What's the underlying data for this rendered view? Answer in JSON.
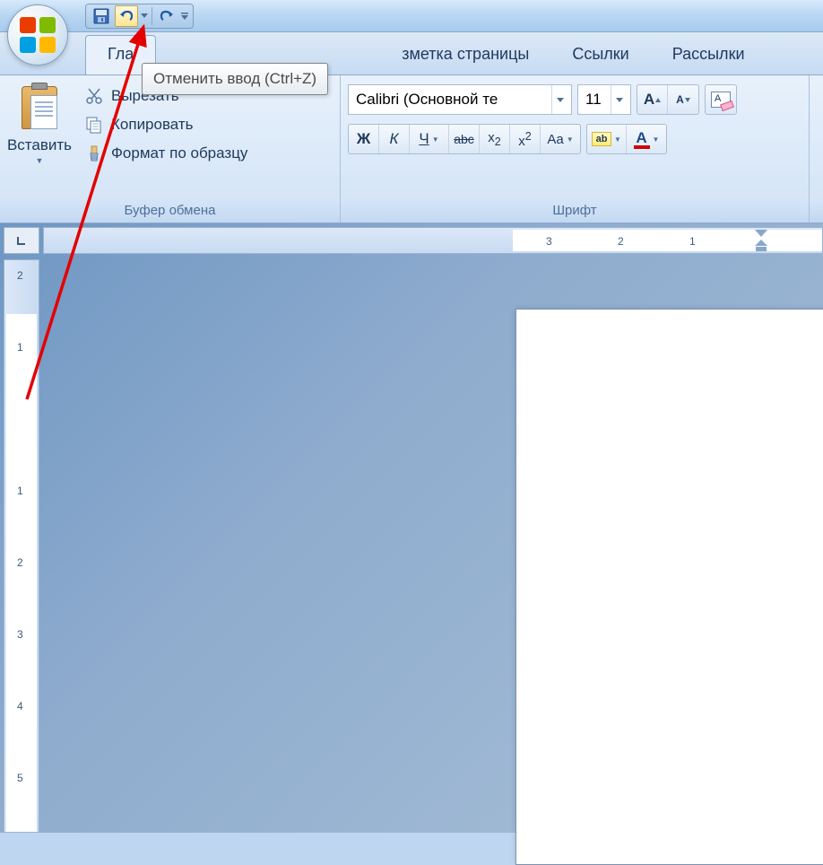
{
  "qat": {
    "save_icon": "save-icon",
    "undo_icon": "undo-icon",
    "redo_icon": "redo-icon"
  },
  "tooltip_text": "Отменить ввод (Ctrl+Z)",
  "tabs": {
    "home": "Гла",
    "page_layout": "зметка страницы",
    "references": "Ссылки",
    "mailings": "Рассылки"
  },
  "clipboard": {
    "paste_label": "Вставить",
    "cut_label": "Вырезать",
    "copy_label": "Копировать",
    "format_painter_label": "Формат по образцу",
    "group_label": "Буфер обмена"
  },
  "font": {
    "font_name": "Calibri (Основной те",
    "font_size": "11",
    "group_label": "Шрифт",
    "bold": "Ж",
    "italic": "К",
    "underline": "Ч",
    "strike": "abc",
    "subscript": "x",
    "subscript_sub": "2",
    "superscript": "x",
    "superscript_sup": "2",
    "changecase": "Aa",
    "hilite_letter": "ab",
    "fontcolor_letter": "A",
    "grow_font": "A",
    "shrink_font": "A",
    "clear_label": ""
  },
  "ruler_h": [
    "3",
    "2",
    "1"
  ],
  "ruler_v": [
    "2",
    "1",
    "1",
    "2",
    "3",
    "4",
    "5"
  ]
}
